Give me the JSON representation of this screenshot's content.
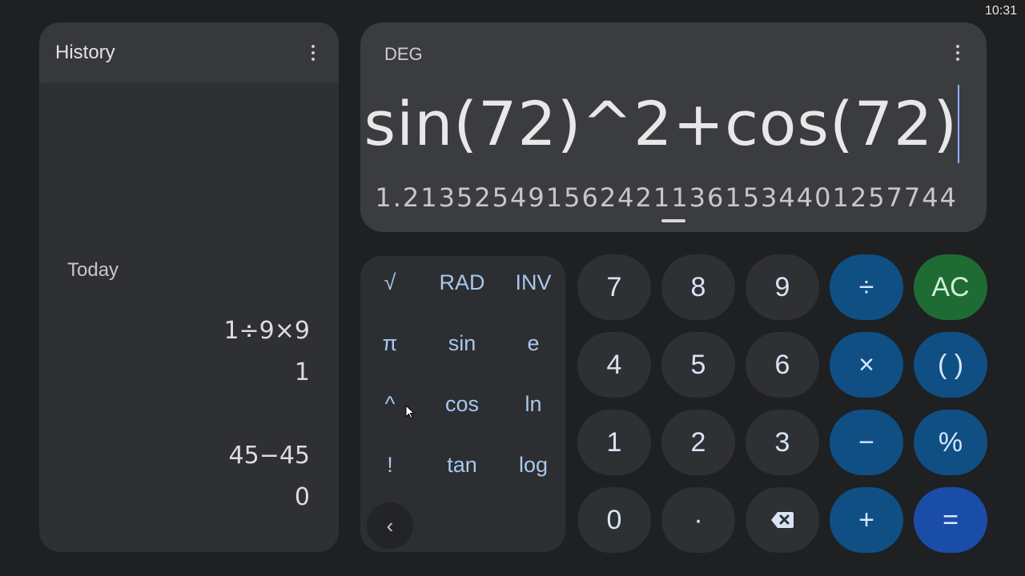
{
  "status_bar": {
    "time": "10:31"
  },
  "history": {
    "title": "History",
    "menu_icon": "more-vert-icon",
    "day_label": "Today",
    "entries": [
      {
        "expression": "1÷9×9",
        "result": "1"
      },
      {
        "expression": "45−45",
        "result": "0"
      }
    ]
  },
  "display": {
    "mode": "DEG",
    "menu_icon": "more-vert-icon",
    "expression": "sin(72)^2+cos(72)",
    "result": "1.2135254915624211361534401257744"
  },
  "scientific": {
    "keys": [
      "√",
      "RAD",
      "INV",
      "π",
      "sin",
      "e",
      "^",
      "cos",
      "ln",
      "!",
      "tan",
      "log"
    ],
    "collapse_icon": "chevron-left-icon",
    "collapse_label": "‹"
  },
  "keypad": {
    "digits": [
      "7",
      "8",
      "9",
      "4",
      "5",
      "6",
      "1",
      "2",
      "3",
      "0"
    ],
    "decimal": "·",
    "backspace_icon": "backspace-icon",
    "divide": "÷",
    "multiply": "×",
    "minus": "−",
    "plus": "+",
    "equals": "=",
    "clear": "AC",
    "parentheses": "( )",
    "percent": "%"
  },
  "colors": {
    "background": "#1f2022",
    "panel": "#2e3033",
    "display": "#3a3c40",
    "operator": "#0f4f84",
    "clear": "#1f6b34",
    "equals": "#1a4da8",
    "sci_text": "#a9c7ee"
  }
}
